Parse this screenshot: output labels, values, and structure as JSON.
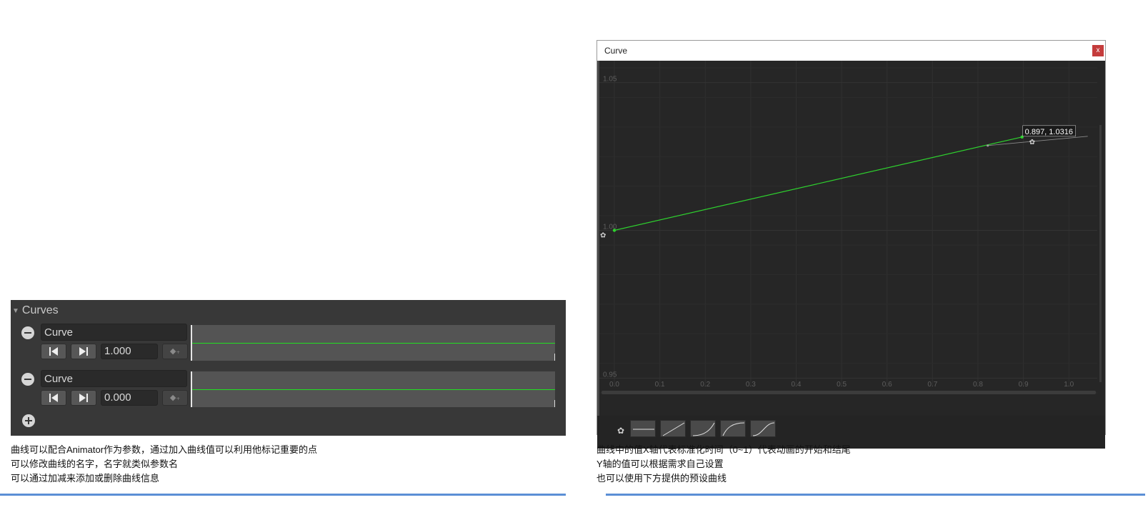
{
  "curves_panel": {
    "title": "Curves",
    "entries": [
      {
        "name": "Curve",
        "value": "1.000",
        "line_level": 0.5
      },
      {
        "name": "Curve",
        "value": "0.000",
        "line_level": 0.5
      }
    ]
  },
  "left_caption": {
    "lines": [
      "曲线可以配合Animator作为参数，通过加入曲线值可以利用他标记重要的点",
      "可以修改曲线的名字，名字就类似参数名",
      "可以通过加减来添加或删除曲线信息"
    ]
  },
  "curve_window": {
    "title": "Curve",
    "close_label": "x",
    "point_readout": "0.897, 1.0316"
  },
  "chart_data": {
    "type": "line",
    "x_ticks": [
      "0.0",
      "0.1",
      "0.2",
      "0.3",
      "0.4",
      "0.5",
      "0.6",
      "0.7",
      "0.8",
      "0.9",
      "1.0"
    ],
    "y_ticks": [
      "1.05",
      "1.00",
      "0.95"
    ],
    "xlim": [
      0.0,
      1.05
    ],
    "ylim": [
      0.945,
      1.055
    ],
    "series": [
      {
        "x": [
          0.0,
          0.897
        ],
        "y": [
          1.0,
          1.0316
        ]
      }
    ],
    "line_color": "#2ed12e",
    "grid": true
  },
  "presets": [
    "flat",
    "linear",
    "ease-in",
    "ease-out",
    "ease-in-out"
  ],
  "right_caption": {
    "lines": [
      "曲线中的值X轴代表标准化时间（0~1）代表动画的开始和结尾",
      "Y轴的值可以根据需求自己设置",
      "也可以使用下方提供的预设曲线"
    ]
  },
  "colors": {
    "panel_bg": "#383838",
    "curve_green": "#22e022",
    "accent_blue": "#5b8fd6"
  }
}
